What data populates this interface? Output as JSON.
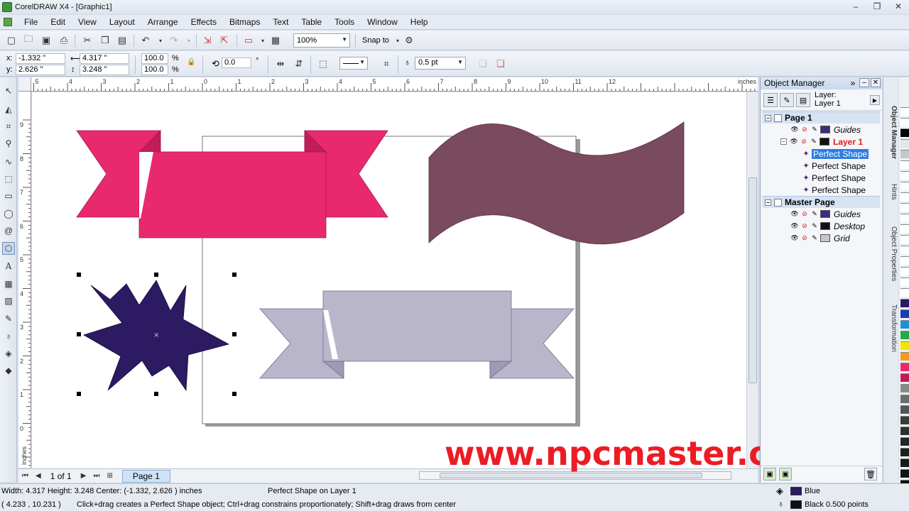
{
  "window": {
    "title": "CorelDRAW X4 - [Graphic1]",
    "minimize": "–",
    "restore": "❐",
    "close": "✕"
  },
  "menu": [
    "File",
    "Edit",
    "View",
    "Layout",
    "Arrange",
    "Effects",
    "Bitmaps",
    "Text",
    "Table",
    "Tools",
    "Window",
    "Help"
  ],
  "standard_toolbar": {
    "zoom": "100%",
    "snap_to": "Snap to"
  },
  "property_bar": {
    "x": "-1.332 \"",
    "y": "2.626 \"",
    "width": "4.317 \"",
    "height": "3.248 \"",
    "scale_x": "100.0",
    "scale_y": "100.0",
    "percent": "%",
    "rotation": "0.0",
    "degree": "°",
    "outline_width": "0.5 pt"
  },
  "ruler": {
    "units": "inches",
    "h_labels": [
      "5",
      "4",
      "3",
      "2",
      "1",
      "0",
      "1",
      "2",
      "3",
      "4",
      "5",
      "6",
      "7",
      "8",
      "9",
      "10",
      "11",
      "12"
    ],
    "v_labels": [
      "9",
      "8",
      "7",
      "6",
      "5",
      "4",
      "3",
      "2",
      "1",
      "0"
    ],
    "v_units": "inches"
  },
  "page_nav": {
    "counter": "1 of 1",
    "tab": "Page 1"
  },
  "object_manager": {
    "title": "Object Manager",
    "layer_label": "Layer:",
    "layer_value": "Layer 1",
    "rows": [
      {
        "label": "Page 1",
        "kind": "group"
      },
      {
        "label": "Guides",
        "kind": "layer",
        "swatch": "#3b2d7a"
      },
      {
        "label": "Layer 1",
        "kind": "active-layer",
        "swatch": "#111111"
      },
      {
        "label": "Perfect Shape",
        "kind": "object-selected"
      },
      {
        "label": "Perfect Shape",
        "kind": "object"
      },
      {
        "label": "Perfect Shape",
        "kind": "object"
      },
      {
        "label": "Perfect Shape",
        "kind": "object"
      },
      {
        "label": "Master Page",
        "kind": "group"
      },
      {
        "label": "Guides",
        "kind": "layer",
        "swatch": "#3b2d7a"
      },
      {
        "label": "Desktop",
        "kind": "layer",
        "swatch": "#111111"
      },
      {
        "label": "Grid",
        "kind": "layer",
        "swatch": "#c7c7c7"
      }
    ]
  },
  "dock_tabs": [
    "Object Manager",
    "Hints",
    "Object Properties",
    "Transformation"
  ],
  "status": {
    "dimensions": "Width: 4.317  Height: 3.248  Center: (-1.332, 2.626 )  inches",
    "object_info": "Perfect Shape on Layer 1",
    "cursor_pos": "( 4.233 , 10.231 )",
    "hint": "Click+drag creates a Perfect Shape object; Ctrl+drag constrains proportionately; Shift+drag draws from center",
    "fill_name": "Blue",
    "outline_name": "Black  0.500 points"
  },
  "colors": {
    "pink": "#e8296d",
    "wine": "#7a4a5f",
    "navy": "#2c1a62",
    "lavender": "#b9b6cc",
    "accent_red": "#ec1c24"
  },
  "watermark": "www.npcmaster.com"
}
